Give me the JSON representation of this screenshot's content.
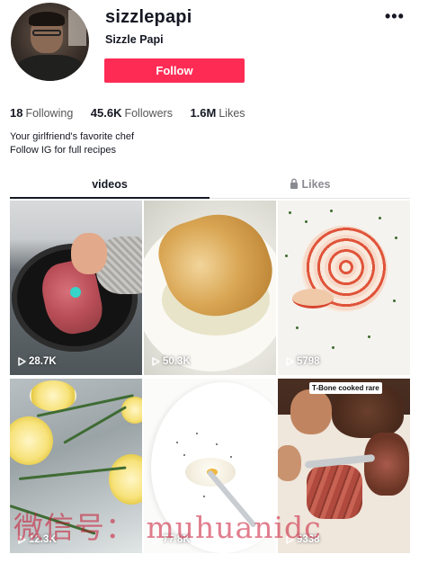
{
  "profile": {
    "username": "sizzlepapi",
    "display_name": "Sizzle Papi",
    "more_label": "•••",
    "follow_label": "Follow"
  },
  "stats": {
    "following_count": "18",
    "following_label": "Following",
    "followers_count": "45.6K",
    "followers_label": "Followers",
    "likes_count": "1.6M",
    "likes_label": "Likes"
  },
  "bio": {
    "line1": "Your girlfriend's favorite chef",
    "line2": "Follow IG for full recipes"
  },
  "tabs": {
    "videos_label": "videos",
    "likes_label": "Likes"
  },
  "videos": [
    {
      "views": "28.7K"
    },
    {
      "views": "50.3K"
    },
    {
      "views": "5798"
    },
    {
      "views": "12.3K"
    },
    {
      "views": "77.8K"
    },
    {
      "views": "9338",
      "caption": "T-Bone cooked rare"
    }
  ],
  "watermark": "微信号： muhuanidc",
  "colors": {
    "accent": "#fe2c55",
    "text": "#161823",
    "muted": "#8a8b91"
  }
}
